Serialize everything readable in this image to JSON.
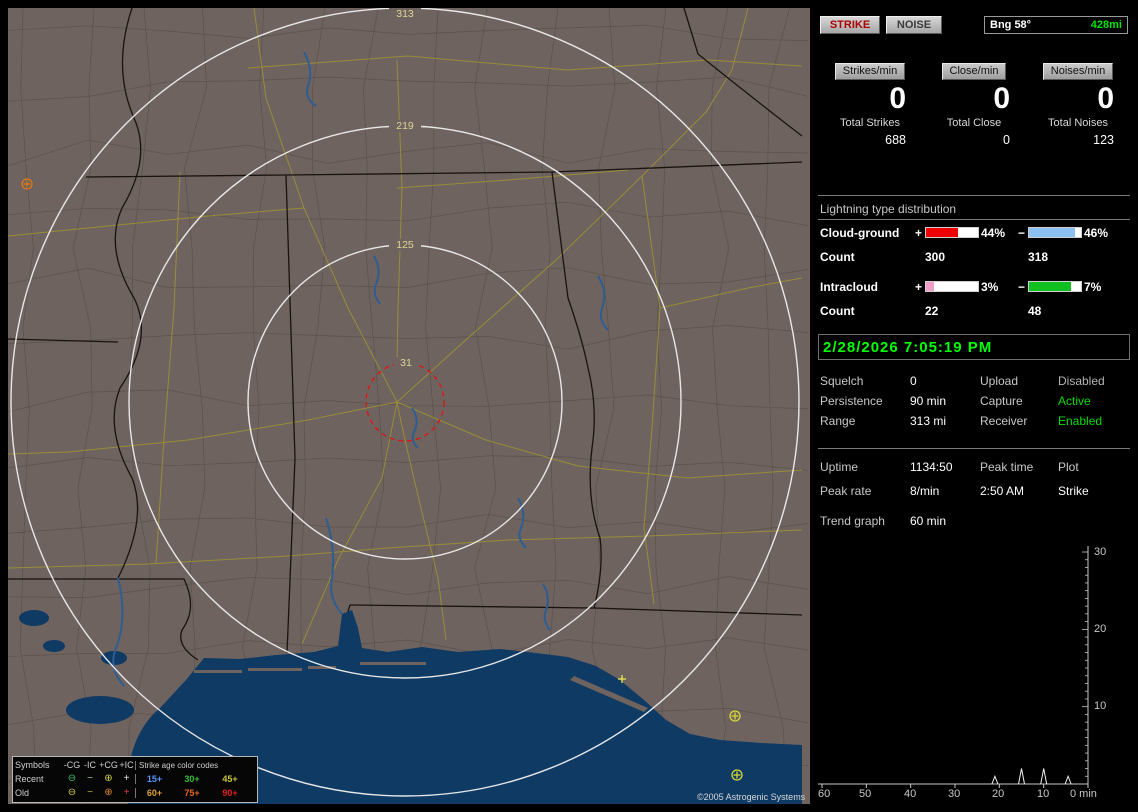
{
  "map": {
    "ring_labels": [
      "313",
      "219",
      "125",
      "31"
    ],
    "copyright": "©2005 Astrogenic Systems",
    "legend": {
      "symbols_header": "Symbols",
      "type_headers": [
        "-CG",
        "-IC",
        "+CG",
        "+IC"
      ],
      "age_header": "Strike age color codes",
      "recent_label": "Recent",
      "old_label": "Old",
      "recent_symbols": [
        {
          "glyph": "⊖",
          "color": "#3fbf6f"
        },
        {
          "glyph": "−",
          "color": "#9fcf9f"
        },
        {
          "glyph": "⊕",
          "color": "#cfcf4f"
        },
        {
          "glyph": "+",
          "color": "#e8e8e8"
        }
      ],
      "old_symbols": [
        {
          "glyph": "⊖",
          "color": "#d8c838"
        },
        {
          "glyph": "−",
          "color": "#d0b830"
        },
        {
          "glyph": "⊕",
          "color": "#e08828"
        },
        {
          "glyph": "+",
          "color": "#e04040"
        }
      ],
      "age_recent": [
        {
          "label": "15+",
          "color": "#5898ff"
        },
        {
          "label": "30+",
          "color": "#38c038"
        },
        {
          "label": "45+",
          "color": "#c8c838"
        }
      ],
      "age_old": [
        {
          "label": "60+",
          "color": "#e0a030"
        },
        {
          "label": "75+",
          "color": "#e86820"
        },
        {
          "label": "90+",
          "color": "#e82020"
        }
      ]
    }
  },
  "panel": {
    "strike_btn": "STRIKE",
    "noise_btn": "NOISE",
    "bearing_label": "Bng 58°",
    "bearing_range": "428mi",
    "bearing_range_color": "#00e400",
    "rate_counters": [
      {
        "label": "Strikes/min",
        "value": "0"
      },
      {
        "label": "Close/min",
        "value": "0"
      },
      {
        "label": "Noises/min",
        "value": "0"
      }
    ],
    "totals": [
      {
        "label": "Total Strikes",
        "value": "688"
      },
      {
        "label": "Total Close",
        "value": "0"
      },
      {
        "label": "Total Noises",
        "value": "123"
      }
    ],
    "distribution": {
      "title": "Lightning type distribution",
      "rows": [
        {
          "label": "Cloud-ground",
          "plus_sign": "+",
          "minus_sign": "−",
          "plus_pct": "44%",
          "minus_pct": "46%",
          "plus_bar": {
            "fill": 62,
            "color": "#ee0000"
          },
          "minus_bar": {
            "fill": 88,
            "color": "#8cc0f0"
          },
          "count_label": "Count",
          "plus_count": "300",
          "minus_count": "318"
        },
        {
          "label": "Intracloud",
          "plus_sign": "+",
          "minus_sign": "−",
          "plus_pct": "3%",
          "minus_pct": "7%",
          "plus_bar": {
            "fill": 16,
            "color": "#f0a0c8"
          },
          "minus_bar": {
            "fill": 80,
            "color": "#10c020"
          },
          "count_label": "Count",
          "plus_count": "22",
          "minus_count": "48"
        }
      ]
    },
    "timestamp": "2/28/2026 7:05:19 PM",
    "timestamp_color": "#00ff00",
    "status": [
      {
        "label": "Squelch",
        "value": "0",
        "label2": "Upload",
        "value2": "Disabled",
        "value2_color": "#b4b4b4"
      },
      {
        "label": "Persistence",
        "value": "90 min",
        "label2": "Capture",
        "value2": "Active",
        "value2_color": "#00dd00"
      },
      {
        "label": "Range",
        "value": "313 mi",
        "label2": "Receiver",
        "value2": "Enabled",
        "value2_color": "#00dd00"
      }
    ],
    "stats_rows": [
      {
        "c1": "Uptime",
        "c2": "1134:50",
        "c3": "Peak time",
        "c4": "Plot",
        "c3_color": "#c8c8c8",
        "c4_color": "#c8c8c8"
      },
      {
        "c1": "Peak rate",
        "c2": "8/min",
        "c3": "2:50 AM",
        "c4": "Strike",
        "c3_color": "#ffffff",
        "c4_color": "#ffffff"
      },
      {
        "c1": "Trend graph",
        "c2": "60 min",
        "c3": "",
        "c4": ""
      }
    ],
    "chart_data": {
      "type": "line",
      "title": "Trend graph",
      "window_label": "60 min",
      "xlabel": "min",
      "x_ticks": [
        "60",
        "50",
        "40",
        "30",
        "20",
        "10"
      ],
      "x_end_label": "0 min",
      "y_ticks": [
        "30",
        "20",
        "10"
      ],
      "ylim": [
        0,
        30
      ],
      "xlim_minutes_ago": [
        60,
        0
      ],
      "series": [
        {
          "name": "Strikes per minute",
          "points": [
            {
              "min_ago": 21,
              "value": 1
            },
            {
              "min_ago": 15,
              "value": 2
            },
            {
              "min_ago": 10,
              "value": 2
            },
            {
              "min_ago": 4.5,
              "value": 1
            }
          ]
        }
      ]
    }
  }
}
